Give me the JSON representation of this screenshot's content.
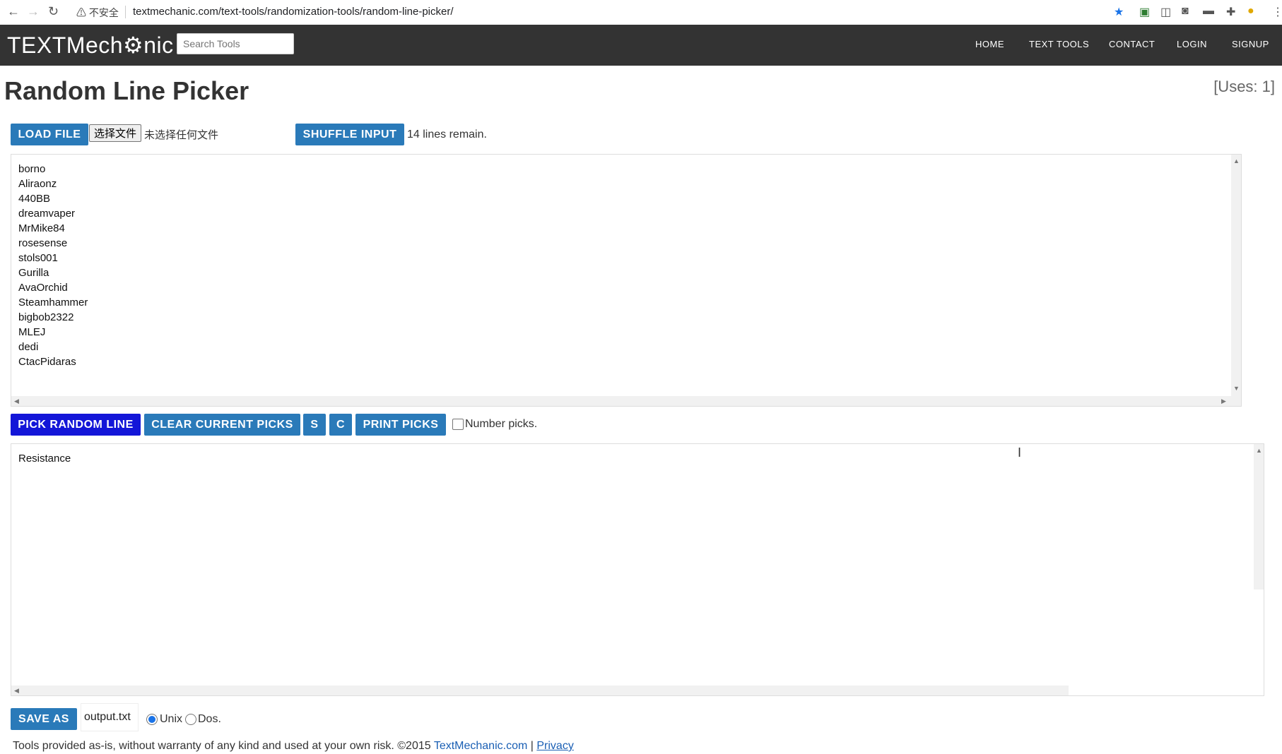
{
  "browser": {
    "security_label": "不安全",
    "url": "textmechanic.com/text-tools/randomization-tools/random-line-picker/"
  },
  "header": {
    "logo": "TEXTMech⚙nic",
    "search_placeholder": "Search Tools",
    "nav": [
      "HOME",
      "TEXT TOOLS",
      "CONTACT",
      "LOGIN",
      "SIGNUP"
    ]
  },
  "page": {
    "title": "Random Line Picker",
    "uses": "[Uses: 1]"
  },
  "input_toolbar": {
    "load_file": "LOAD FILE",
    "choose_file": "选择文件",
    "no_file": "未选择任何文件",
    "shuffle": "SHUFFLE INPUT",
    "remain": "14 lines remain."
  },
  "input_lines": [
    "borno",
    "Aliraonz",
    "440BB",
    "dreamvaper",
    "MrMike84",
    "rosesense",
    "stols001",
    "Gurilla",
    "AvaOrchid",
    "Steamhammer",
    "bigbob2322",
    "MLEJ",
    "dedi",
    "CtacPidaras"
  ],
  "pick_toolbar": {
    "pick": "PICK RANDOM LINE",
    "clear": "CLEAR CURRENT PICKS",
    "s": "S",
    "c": "C",
    "print": "PRINT PICKS",
    "number_picks": "Number picks."
  },
  "output_lines": [
    "Resistance"
  ],
  "save": {
    "save_as": "SAVE AS",
    "filename": "output.txt",
    "unix": "Unix",
    "dos": "Dos."
  },
  "footer": {
    "text": "Tools provided as-is, without warranty of any kind and used at your own risk. ©2015 ",
    "link": "TextMechanic.com",
    "divider": " | ",
    "privacy": "Privacy"
  },
  "colors": {
    "accent": "#2a7ab9",
    "pick": "#1316d8",
    "topbar": "#333333"
  }
}
